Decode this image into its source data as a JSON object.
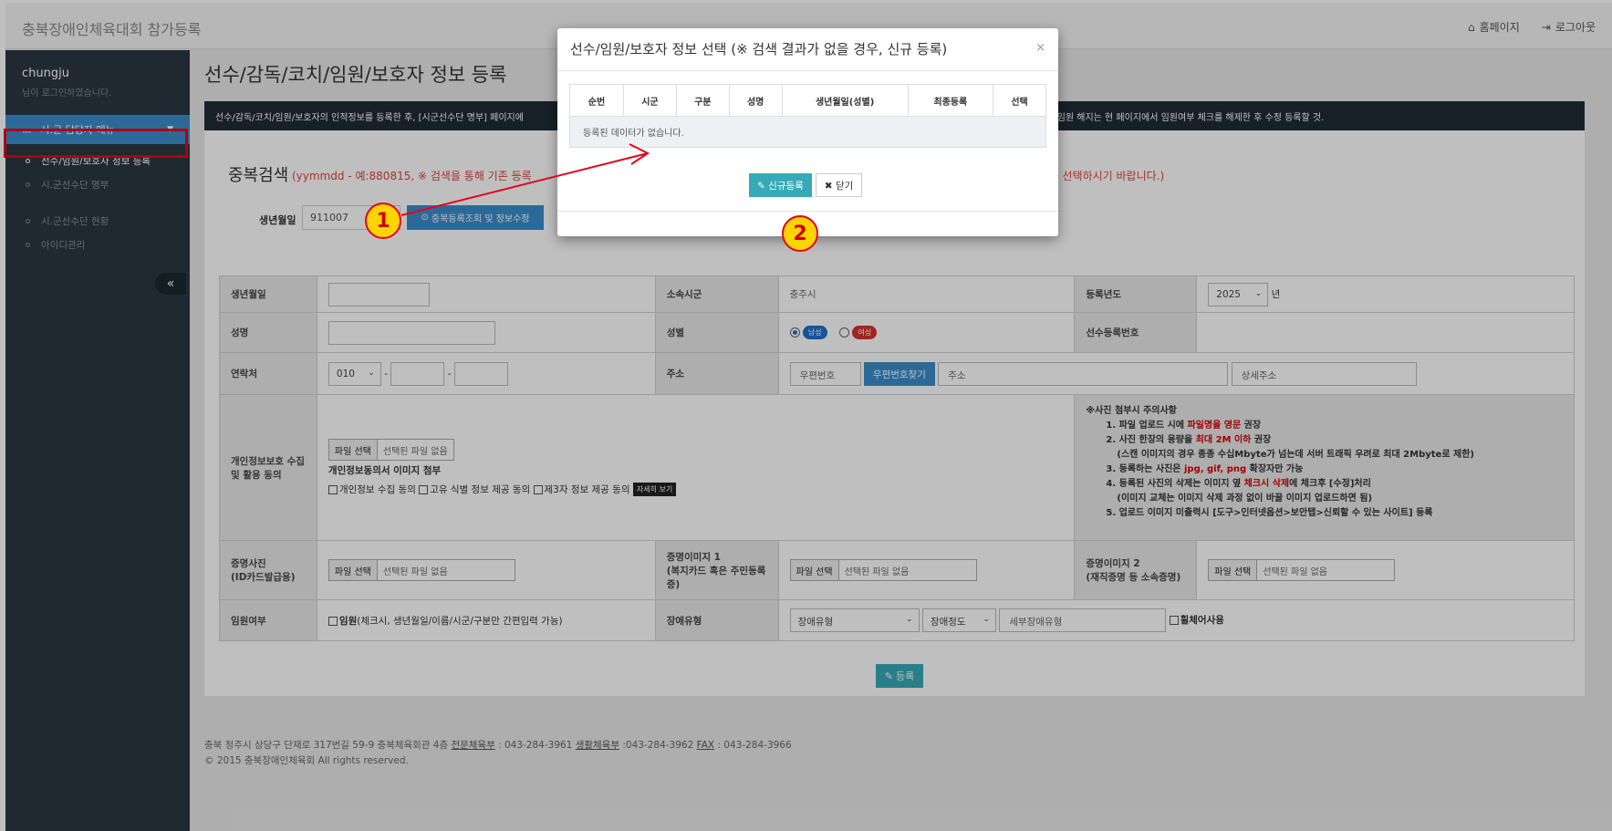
{
  "app": {
    "brand": "충북장애인체육대회 참가등록",
    "links": {
      "home": "홈페이지",
      "logout": "로그아웃"
    }
  },
  "sidebar": {
    "user_name": "chungju",
    "user_sub": "님이 로그인하였습니다.",
    "menu_head": "시.군 담당자 메뉴",
    "items": [
      {
        "label": "선수/임원/보호자 정보 등록",
        "active": true
      },
      {
        "label": "시.군선수단 명부"
      },
      {
        "label": "시.군선수단 현황"
      },
      {
        "label": "아이디관리"
      }
    ],
    "collapse": "«"
  },
  "main": {
    "title": "선수/감독/코치/임원/보호자 정보 등록",
    "notice_left": "선수/감독/코치/임원/보호자의 인적정보를 등록한 후, [시군선수단 명부] 페이지에",
    "notice_right": "하며, 임원 해지는 현 페이지에서 임원여부 체크를 해제한 후 수정 등록할 것.",
    "dup_title": "중복검색",
    "dup_hint": "(yymmdd - 예:880815, ※ 검색을 통해 기존 등록",
    "dup_hint2": ") 선택하시기 바랍니다.)",
    "birth_label": "생년월일",
    "birth_value": "911007",
    "dup_button": "중복등록조회 및 정보수정"
  },
  "form": {
    "birth": "생년월일",
    "city": "소속시군",
    "city_value": "충주시",
    "year_label": "등록년도",
    "year_value": "2025",
    "year_suffix": "년",
    "name": "성명",
    "gender": "성별",
    "male": "남성",
    "female": "여성",
    "athlete_no": "선수등록번호",
    "contact": "연락처",
    "phone_prefix": "010",
    "dash": "-",
    "address": "주소",
    "zip_ph": "우편번호",
    "zip_btn": "우편번호찾기",
    "addr_ph": "주소",
    "addr_detail_ph": "상세주소",
    "privacy": "개인정보보호 수집 및 활용 동의",
    "file_btn": "파일 선택",
    "file_none": "선택된 파일 없음",
    "consent_img": "개인정보동의서 이미지 첨부",
    "consent1": "개인정보 수집 동의",
    "consent2": "고유 식별 정보 제공 동의",
    "consent3": "제3자 정보 제공 동의",
    "detail_btn": "자세히 보기",
    "notes_title": "※사진 첨부시 주의사항",
    "note1a": "1. 파일 업로드 시에 ",
    "note1b": "파일명을 영문",
    "note1c": " 권장",
    "note2a": "2. 사진 한장의 용량을 ",
    "note2b": "최대 2M 이하",
    "note2c": " 권장",
    "note2d": "(스캔 이미지의 경우 종종 수십Mbyte가 넘는데 서버 트래픽 우려로 최대 2Mbyte로 제한)",
    "note3a": "3. 등록하는 사진은 ",
    "note3b": "jpg, gif, png",
    "note3c": " 확장자만 가능",
    "note4a": "4. 등록된 사진의 삭제는 이미지 옆 ",
    "note4b": "체크시 삭제",
    "note4c": "에 체크후 [수정]처리",
    "note4d": "(이미지 교체는 이미지 삭제 과정 없이 바꿀 이미지 업로드하면 됨)",
    "note5": "5. 업로드 이미지 미출력시 [도구>인터넷옵션>보안탭>신뢰할 수 있는 사이트] 등록",
    "photo_a": "증명사진",
    "photo_b": "(ID카드발급용)",
    "img1_a": "증명이미지 1",
    "img1_b": "(복지카드 혹은 주민등록증)",
    "img2_a": "증명이미지 2",
    "img2_b": "(재직증명 등 소속증명)",
    "officer": "임원여부",
    "officer_chk_bold": "임원",
    "officer_chk_rest": "(체크시, 생년월일/이름/시군/구분만 간편입력 가능)",
    "disability": "장애유형",
    "dis_type": "장애유형",
    "dis_level": "장애정도",
    "dis_detail_ph": "세부장애유형",
    "wheelchair": "휠체어사용",
    "submit": "등록"
  },
  "footer": {
    "line1a": "충북 청주시 상당구 단재로 317번길 59-9 충북체육회관 4층  ",
    "line1b": "전문체육부",
    "line1c": " : 043-284-3961  ",
    "line1d": "생활체육부",
    "line1e": " :043-284-3962  ",
    "line1f": "FAX",
    "line1g": " : 043-284-3966",
    "line2": "© 2015 충북장애인체육회 All rights reserved."
  },
  "modal": {
    "title": "선수/임원/보호자 정보 선택 (※ 검색 결과가 없을 경우, 신규 등록)",
    "close": "×",
    "columns": [
      "순번",
      "시군",
      "구분",
      "성명",
      "생년월일(성별)",
      "최종등록",
      "선택"
    ],
    "empty": "등록된 데이터가 없습니다.",
    "new_btn": "신규등록",
    "close_btn": "닫기"
  },
  "callouts": [
    "1",
    "2"
  ],
  "colors": {
    "accent": "#3a8ecb",
    "teal": "#36aab8",
    "sidebar": "#2b3643",
    "highlight": "#e8001c",
    "callout": "#ffd400"
  }
}
